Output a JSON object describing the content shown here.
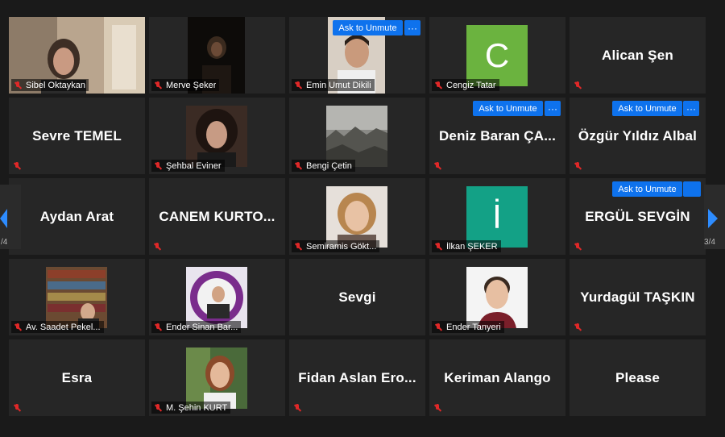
{
  "page": {
    "current": 3,
    "total": 4
  },
  "pager": {
    "left_label": "/4",
    "right_label": "3/4"
  },
  "controls": {
    "ask_to_unmute": "Ask to Unmute",
    "more": "···"
  },
  "colors": {
    "accent": "#0e72ed",
    "tile_bg": "#262626",
    "muted": "#e02828"
  },
  "participants": [
    {
      "name": "Sibel Oktaykan",
      "kind": "video",
      "muted": true
    },
    {
      "name": "Merve Şeker",
      "kind": "video",
      "muted": true
    },
    {
      "name": "Emin Umut Dikili",
      "kind": "video",
      "muted": true,
      "ask_unmute": true
    },
    {
      "name": "Cengiz Tatar",
      "kind": "letter",
      "letter": "C",
      "letter_color": "#6bb33f",
      "muted": true
    },
    {
      "name": "Alican Şen",
      "kind": "name",
      "muted": true
    },
    {
      "name": "Sevre TEMEL",
      "kind": "name",
      "muted": true
    },
    {
      "name": "Şehbal Eviner",
      "kind": "video",
      "muted": true
    },
    {
      "name": "Bengi Çetin",
      "kind": "video",
      "muted": true
    },
    {
      "name": "Deniz Baran ÇA...",
      "kind": "name",
      "muted": true,
      "ask_unmute": true
    },
    {
      "name": "Özgür Yıldız Albal",
      "kind": "name",
      "muted": true,
      "ask_unmute": true
    },
    {
      "name": "Aydan Arat",
      "kind": "name",
      "muted": false
    },
    {
      "name": "CANEM KURTO...",
      "kind": "name",
      "muted": true
    },
    {
      "name": "Semiramis Gökt...",
      "kind": "video",
      "muted": true
    },
    {
      "name": "İlkan ŞEKER",
      "kind": "letter",
      "letter": "İ",
      "letter_color": "#13a186",
      "muted": true
    },
    {
      "name": "ERGÜL SEVGİN",
      "kind": "name",
      "muted": true,
      "ask_unmute": true
    },
    {
      "name": "Av. Saadet Pekel...",
      "kind": "video",
      "muted": true
    },
    {
      "name": "Ender Sinan Bar...",
      "kind": "video",
      "muted": true
    },
    {
      "name": "Sevgi",
      "kind": "name",
      "muted": false
    },
    {
      "name": "Ender Tanyeri",
      "kind": "video",
      "muted": true
    },
    {
      "name": "Yurdagül TAŞKIN",
      "kind": "name",
      "muted": true
    },
    {
      "name": "Esra",
      "kind": "name",
      "muted": true
    },
    {
      "name": "M. Şehin KURT",
      "kind": "video",
      "muted": true
    },
    {
      "name": "Fidan Aslan Ero...",
      "kind": "name",
      "muted": true
    },
    {
      "name": "Keriman Alango",
      "kind": "name",
      "muted": true
    },
    {
      "name": "Please",
      "kind": "name",
      "muted": false
    }
  ]
}
